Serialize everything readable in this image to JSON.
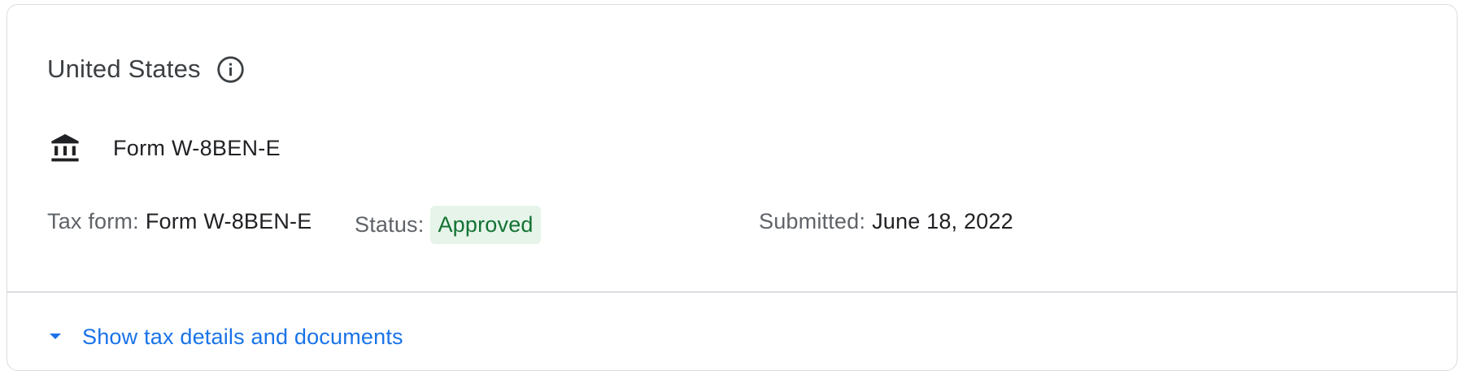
{
  "section": {
    "country": "United States",
    "info_icon": "info-icon"
  },
  "form": {
    "icon": "bank-building-icon",
    "name": "Form W-8BEN-E"
  },
  "details": {
    "tax_form_label": "Tax form:",
    "tax_form_value": "Form W-8BEN-E",
    "status_label": "Status:",
    "status_value": "Approved",
    "submitted_label": "Submitted:",
    "submitted_value": "June 18, 2022"
  },
  "expander": {
    "icon": "caret-down-icon",
    "label": "Show tax details and documents"
  },
  "colors": {
    "accent": "#1a73e8",
    "status_bg": "#e6f4ea",
    "status_text": "#137333",
    "border": "#dadce0"
  }
}
